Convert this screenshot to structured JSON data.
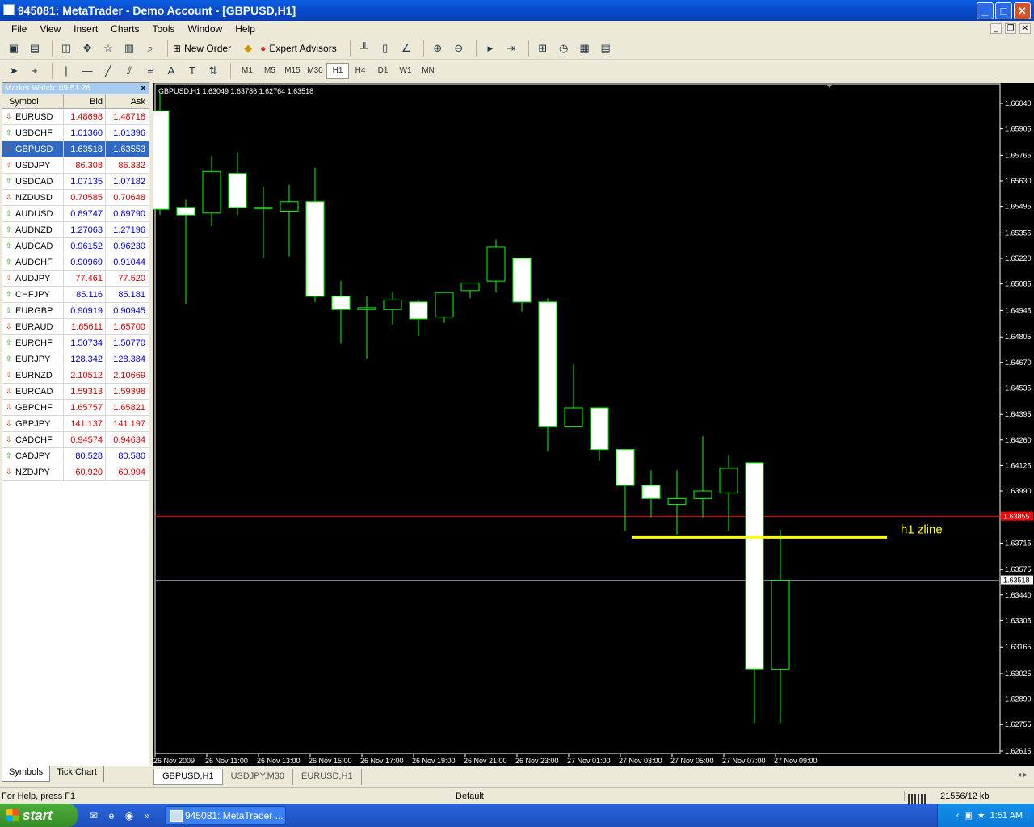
{
  "window": {
    "title": "945081: MetaTrader - Demo Account - [GBPUSD,H1]"
  },
  "menu": [
    "File",
    "View",
    "Insert",
    "Charts",
    "Tools",
    "Window",
    "Help"
  ],
  "toolbar": {
    "new_order": "New Order",
    "expert_advisors": "Expert Advisors",
    "timeframes": [
      "M1",
      "M5",
      "M15",
      "M30",
      "H1",
      "H4",
      "D1",
      "W1",
      "MN"
    ],
    "active_timeframe": "H1"
  },
  "market_watch": {
    "title": "Market Watch: 09:51:26",
    "headers": {
      "symbol": "Symbol",
      "bid": "Bid",
      "ask": "Ask"
    },
    "rows": [
      {
        "symbol": "EURUSD",
        "bid": "1.48698",
        "ask": "1.48718",
        "dir": "down",
        "color": "red"
      },
      {
        "symbol": "USDCHF",
        "bid": "1.01360",
        "ask": "1.01396",
        "dir": "up",
        "color": "blue"
      },
      {
        "symbol": "GBPUSD",
        "bid": "1.63518",
        "ask": "1.63553",
        "dir": "down",
        "color": "red",
        "selected": true
      },
      {
        "symbol": "USDJPY",
        "bid": "86.308",
        "ask": "86.332",
        "dir": "down",
        "color": "red"
      },
      {
        "symbol": "USDCAD",
        "bid": "1.07135",
        "ask": "1.07182",
        "dir": "up",
        "color": "blue"
      },
      {
        "symbol": "NZDUSD",
        "bid": "0.70585",
        "ask": "0.70648",
        "dir": "down",
        "color": "red"
      },
      {
        "symbol": "AUDUSD",
        "bid": "0.89747",
        "ask": "0.89790",
        "dir": "up",
        "color": "blue"
      },
      {
        "symbol": "AUDNZD",
        "bid": "1.27063",
        "ask": "1.27196",
        "dir": "up",
        "color": "blue"
      },
      {
        "symbol": "AUDCAD",
        "bid": "0.96152",
        "ask": "0.96230",
        "dir": "up",
        "color": "blue"
      },
      {
        "symbol": "AUDCHF",
        "bid": "0.90969",
        "ask": "0.91044",
        "dir": "up",
        "color": "blue"
      },
      {
        "symbol": "AUDJPY",
        "bid": "77.461",
        "ask": "77.520",
        "dir": "down",
        "color": "red"
      },
      {
        "symbol": "CHFJPY",
        "bid": "85.116",
        "ask": "85.181",
        "dir": "up",
        "color": "blue"
      },
      {
        "symbol": "EURGBP",
        "bid": "0.90919",
        "ask": "0.90945",
        "dir": "up",
        "color": "blue"
      },
      {
        "symbol": "EURAUD",
        "bid": "1.65611",
        "ask": "1.65700",
        "dir": "down",
        "color": "red"
      },
      {
        "symbol": "EURCHF",
        "bid": "1.50734",
        "ask": "1.50770",
        "dir": "up",
        "color": "blue"
      },
      {
        "symbol": "EURJPY",
        "bid": "128.342",
        "ask": "128.384",
        "dir": "up",
        "color": "blue"
      },
      {
        "symbol": "EURNZD",
        "bid": "2.10512",
        "ask": "2.10669",
        "dir": "down",
        "color": "red"
      },
      {
        "symbol": "EURCAD",
        "bid": "1.59313",
        "ask": "1.59398",
        "dir": "down",
        "color": "red"
      },
      {
        "symbol": "GBPCHF",
        "bid": "1.65757",
        "ask": "1.65821",
        "dir": "down",
        "color": "red"
      },
      {
        "symbol": "GBPJPY",
        "bid": "141.137",
        "ask": "141.197",
        "dir": "down",
        "color": "red"
      },
      {
        "symbol": "CADCHF",
        "bid": "0.94574",
        "ask": "0.94634",
        "dir": "down",
        "color": "red"
      },
      {
        "symbol": "CADJPY",
        "bid": "80.528",
        "ask": "80.580",
        "dir": "up",
        "color": "blue"
      },
      {
        "symbol": "NZDJPY",
        "bid": "60.920",
        "ask": "60.994",
        "dir": "down",
        "color": "red"
      }
    ],
    "tabs": [
      "Symbols",
      "Tick Chart"
    ]
  },
  "chart": {
    "header": "GBPUSD,H1  1.63049 1.63786 1.62764 1.63518",
    "price_labels": [
      "1.66040",
      "1.65905",
      "1.65765",
      "1.65630",
      "1.65495",
      "1.65355",
      "1.65220",
      "1.65085",
      "1.64945",
      "1.64805",
      "1.64670",
      "1.64535",
      "1.64395",
      "1.64260",
      "1.64125",
      "1.63990",
      "1.63855",
      "1.63715",
      "1.63575",
      "1.63518",
      "1.63440",
      "1.63305",
      "1.63165",
      "1.63025",
      "1.62890",
      "1.62755",
      "1.62615"
    ],
    "time_labels": [
      "26 Nov 2009",
      "26 Nov 11:00",
      "26 Nov 13:00",
      "26 Nov 15:00",
      "26 Nov 17:00",
      "26 Nov 19:00",
      "26 Nov 21:00",
      "26 Nov 23:00",
      "27 Nov 01:00",
      "27 Nov 03:00",
      "27 Nov 05:00",
      "27 Nov 07:00",
      "27 Nov 09:00"
    ],
    "ask_line_label": "1.63855",
    "bid_line_label": "1.63518",
    "zline_label": "h1 zline",
    "colors": {
      "bg": "#000000",
      "wick": "#00ff00",
      "bull_fill": "#000000",
      "bear_fill": "#ffffff",
      "zline": "#ffff00",
      "ask": "#ff0000",
      "bid": "#778899"
    },
    "zline_price": 1.63745,
    "ask_price": 1.63855,
    "bid_price": 1.63518
  },
  "chart_data": {
    "type": "candlestick",
    "symbol": "GBPUSD",
    "timeframe": "H1",
    "ylim": [
      1.62615,
      1.6604
    ],
    "candles": [
      {
        "t": "26 Nov 09:00",
        "o": 1.66,
        "h": 1.661,
        "l": 1.6545,
        "c": 1.6548
      },
      {
        "t": "26 Nov 10:00",
        "o": 1.6549,
        "h": 1.6553,
        "l": 1.6498,
        "c": 1.6545
      },
      {
        "t": "26 Nov 11:00",
        "o": 1.6546,
        "h": 1.6576,
        "l": 1.6539,
        "c": 1.6568
      },
      {
        "t": "26 Nov 12:00",
        "o": 1.6567,
        "h": 1.6578,
        "l": 1.6545,
        "c": 1.6549
      },
      {
        "t": "26 Nov 13:00",
        "o": 1.6549,
        "h": 1.656,
        "l": 1.6522,
        "c": 1.6549
      },
      {
        "t": "26 Nov 14:00",
        "o": 1.6547,
        "h": 1.6561,
        "l": 1.6523,
        "c": 1.6552
      },
      {
        "t": "26 Nov 15:00",
        "o": 1.6552,
        "h": 1.657,
        "l": 1.6499,
        "c": 1.6502
      },
      {
        "t": "26 Nov 16:00",
        "o": 1.6502,
        "h": 1.651,
        "l": 1.6477,
        "c": 1.6495
      },
      {
        "t": "26 Nov 17:00",
        "o": 1.6495,
        "h": 1.6502,
        "l": 1.6469,
        "c": 1.6496
      },
      {
        "t": "26 Nov 18:00",
        "o": 1.6495,
        "h": 1.6504,
        "l": 1.6487,
        "c": 1.65
      },
      {
        "t": "26 Nov 19:00",
        "o": 1.6499,
        "h": 1.65,
        "l": 1.6481,
        "c": 1.649
      },
      {
        "t": "26 Nov 20:00",
        "o": 1.6491,
        "h": 1.6504,
        "l": 1.6488,
        "c": 1.6504
      },
      {
        "t": "26 Nov 21:00",
        "o": 1.6505,
        "h": 1.6509,
        "l": 1.6501,
        "c": 1.6509
      },
      {
        "t": "26 Nov 22:00",
        "o": 1.651,
        "h": 1.6532,
        "l": 1.6504,
        "c": 1.6528
      },
      {
        "t": "26 Nov 23:00",
        "o": 1.6522,
        "h": 1.6522,
        "l": 1.6494,
        "c": 1.6499
      },
      {
        "t": "27 Nov 00:00",
        "o": 1.6499,
        "h": 1.6501,
        "l": 1.642,
        "c": 1.6433
      },
      {
        "t": "27 Nov 01:00",
        "o": 1.6433,
        "h": 1.6466,
        "l": 1.6433,
        "c": 1.6443
      },
      {
        "t": "27 Nov 02:00",
        "o": 1.6443,
        "h": 1.6443,
        "l": 1.6415,
        "c": 1.6421
      },
      {
        "t": "27 Nov 03:00",
        "o": 1.6421,
        "h": 1.6421,
        "l": 1.6378,
        "c": 1.6402
      },
      {
        "t": "27 Nov 04:00",
        "o": 1.6402,
        "h": 1.641,
        "l": 1.6385,
        "c": 1.6395
      },
      {
        "t": "27 Nov 05:00",
        "o": 1.6392,
        "h": 1.641,
        "l": 1.6376,
        "c": 1.6395
      },
      {
        "t": "27 Nov 06:00",
        "o": 1.6395,
        "h": 1.6428,
        "l": 1.6385,
        "c": 1.6399
      },
      {
        "t": "27 Nov 07:00",
        "o": 1.6398,
        "h": 1.6418,
        "l": 1.6378,
        "c": 1.6411
      },
      {
        "t": "27 Nov 08:00",
        "o": 1.6414,
        "h": 1.6414,
        "l": 1.62764,
        "c": 1.6305
      },
      {
        "t": "27 Nov 09:00",
        "o": 1.63049,
        "h": 1.63786,
        "l": 1.62764,
        "c": 1.63518
      }
    ]
  },
  "chart_tabs": [
    "GBPUSD,H1",
    "USDJPY,M30",
    "EURUSD,H1"
  ],
  "status": {
    "help": "For Help, press F1",
    "profile": "Default",
    "traffic": "21556/12 kb"
  },
  "taskbar": {
    "start": "start",
    "task": "945081: MetaTrader ...",
    "clock": "1:51 AM"
  }
}
